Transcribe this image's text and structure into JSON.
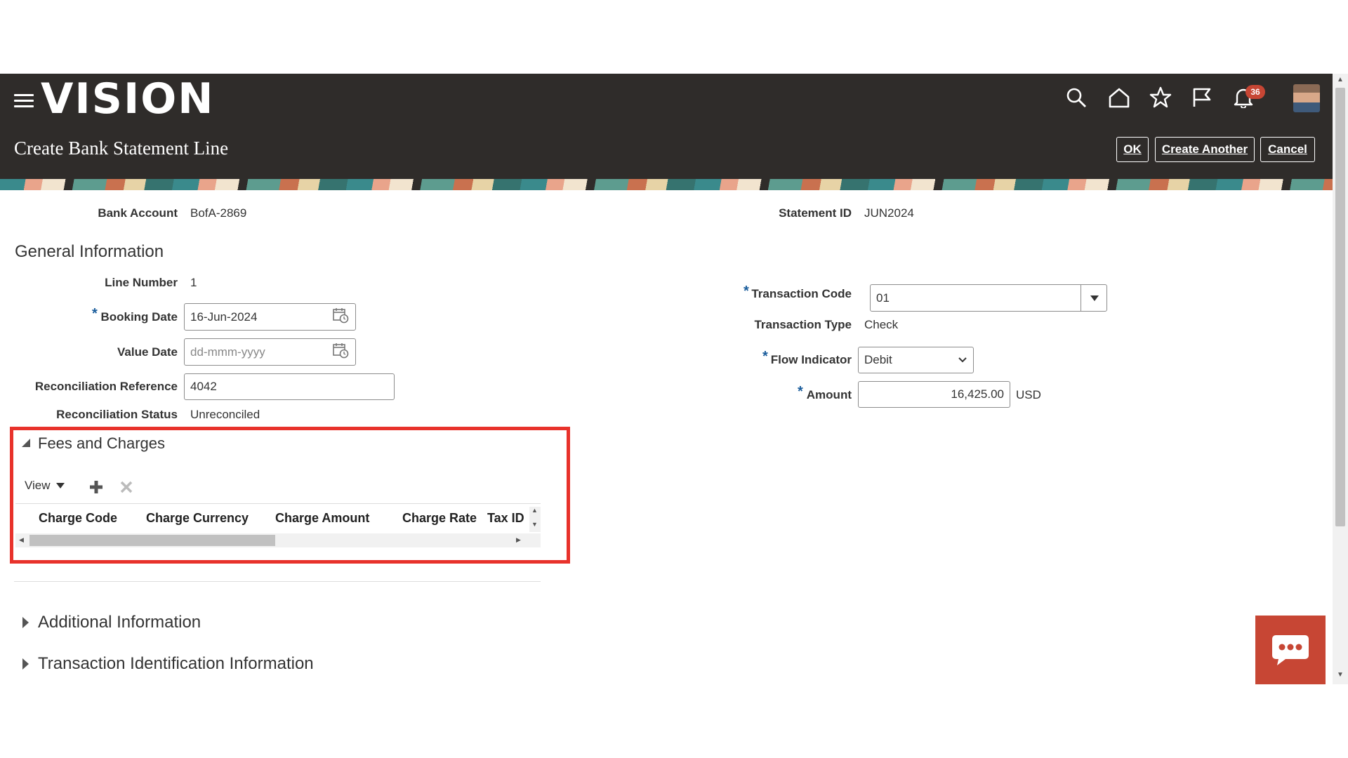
{
  "header": {
    "logo": "VISION",
    "page_title": "Create Bank Statement Line",
    "notification_count": "36",
    "buttons": {
      "ok": "OK",
      "create_another": "Create Another",
      "cancel": "Cancel"
    },
    "icons": [
      "hamburger-icon",
      "search-icon",
      "home-icon",
      "star-icon",
      "flag-icon",
      "bell-icon"
    ]
  },
  "top_fields": {
    "bank_account_label": "Bank Account",
    "bank_account_value": "BofA-2869",
    "statement_id_label": "Statement ID",
    "statement_id_value": "JUN2024"
  },
  "general": {
    "title": "General Information",
    "line_number_label": "Line Number",
    "line_number_value": "1",
    "booking_date_label": "Booking Date",
    "booking_date_value": "16-Jun-2024",
    "value_date_label": "Value Date",
    "value_date_placeholder": "dd-mmm-yyyy",
    "recon_ref_label": "Reconciliation Reference",
    "recon_ref_value": "4042",
    "recon_status_label": "Reconciliation Status",
    "recon_status_value": "Unreconciled",
    "transaction_code_label": "Transaction Code",
    "transaction_code_value": "01",
    "transaction_type_label": "Transaction Type",
    "transaction_type_value": "Check",
    "flow_indicator_label": "Flow Indicator",
    "flow_indicator_value": "Debit",
    "amount_label": "Amount",
    "amount_value": "16,425.00",
    "currency": "USD"
  },
  "fees": {
    "title": "Fees and Charges",
    "view_label": "View",
    "columns": [
      "Charge Code",
      "Charge Currency",
      "Charge Amount",
      "Charge Rate",
      "Tax ID"
    ]
  },
  "sections": {
    "additional": "Additional Information",
    "transaction_id": "Transaction Identification Information"
  },
  "colors": {
    "header_bg": "#2f2c2a",
    "accent_red": "#c74634",
    "highlight": "#e8322b",
    "required": "#1a5d9c"
  }
}
